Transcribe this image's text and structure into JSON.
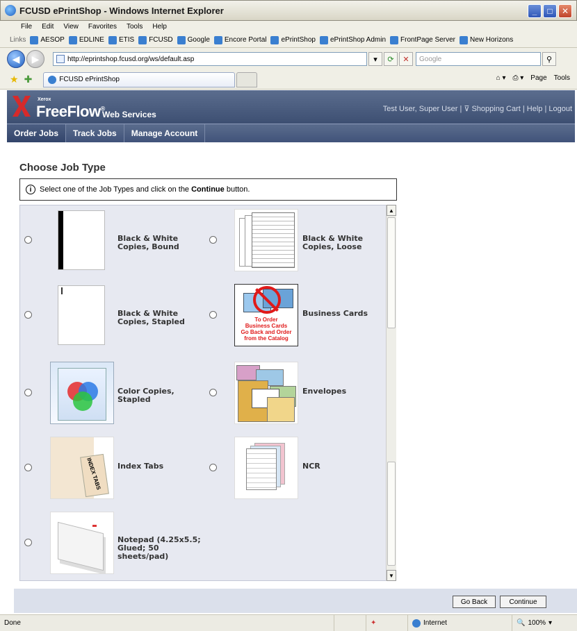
{
  "window": {
    "title": "FCUSD ePrintShop - Windows Internet Explorer"
  },
  "menu": [
    "File",
    "Edit",
    "View",
    "Favorites",
    "Tools",
    "Help"
  ],
  "links": {
    "label": "Links",
    "items": [
      "AESOP",
      "EDLINE",
      "ETIS",
      "FCUSD",
      "Google",
      "Encore Portal",
      "ePrintShop",
      "ePrintShop Admin",
      "FrontPage Server",
      "New Horizons"
    ]
  },
  "address": {
    "url": "http://eprintshop.fcusd.org/ws/default.asp",
    "search_placeholder": "Google"
  },
  "tab": {
    "title": "FCUSD ePrintShop"
  },
  "commands": {
    "page": "Page",
    "tools": "Tools"
  },
  "header": {
    "brand_small": "Xerox",
    "product": "FreeFlow",
    "reg": "®",
    "sub": "Web Services",
    "user_links": "Test User, Super User | ⊽ Shopping Cart | Help | Logout"
  },
  "nav": [
    "Order Jobs",
    "Track Jobs",
    "Manage Account"
  ],
  "main": {
    "heading": "Choose Job Type",
    "info_prefix": "Select one of the Job Types and click on the ",
    "info_bold": "Continue",
    "info_suffix": " button."
  },
  "jobs": [
    {
      "l1": "Black & White",
      "l2": "Copies, Bound",
      "l3": "",
      "l4": ""
    },
    {
      "l1": "Black & White",
      "l2": "Copies, Loose",
      "l3": "",
      "l4": ""
    },
    {
      "l1": "Black & White",
      "l2": "Copies, Stapled",
      "l3": "",
      "l4": ""
    },
    {
      "l1": "Business Cards",
      "l2": "",
      "l3": "",
      "l4": ""
    },
    {
      "l1": "Color Copies,",
      "l2": "Stapled",
      "l3": "",
      "l4": ""
    },
    {
      "l1": "Envelopes",
      "l2": "",
      "l3": "",
      "l4": ""
    },
    {
      "l1": "Index Tabs",
      "l2": "",
      "l3": "",
      "l4": ""
    },
    {
      "l1": "NCR",
      "l2": "",
      "l3": "",
      "l4": ""
    },
    {
      "l1": "Notepad (4.25x5.5;",
      "l2": "Glued; 50",
      "l3": "sheets/pad)",
      "l4": ""
    }
  ],
  "business_card_note": {
    "line1": "To Order",
    "line2": "Business Cards",
    "line3": "Go Back and Order",
    "line4": "from the Catalog"
  },
  "index_tab_text": "INDEX TABS",
  "buttons": {
    "back": "Go Back",
    "continue": "Continue"
  },
  "status": {
    "left": "Done",
    "zone": "Internet",
    "zoom": "100%"
  }
}
